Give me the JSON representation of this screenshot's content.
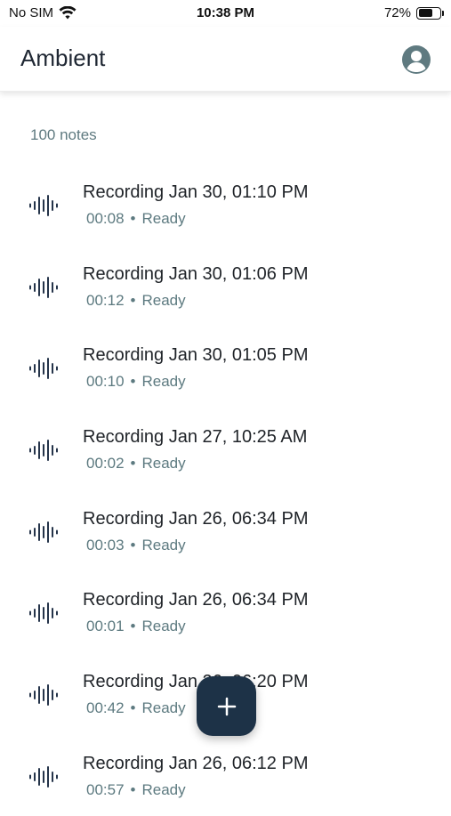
{
  "status_bar": {
    "carrier": "No SIM",
    "time": "10:38 PM",
    "battery_percent": "72%",
    "battery_level": 0.72
  },
  "header": {
    "title": "Ambient",
    "account_icon": "account-circle-icon"
  },
  "notes_count": "100 notes",
  "recordings": [
    {
      "title": "Recording Jan 30, 01:10 PM",
      "duration": "00:08",
      "status": "Ready"
    },
    {
      "title": "Recording Jan 30, 01:06 PM",
      "duration": "00:12",
      "status": "Ready"
    },
    {
      "title": "Recording Jan 30, 01:05 PM",
      "duration": "00:10",
      "status": "Ready"
    },
    {
      "title": "Recording Jan 27, 10:25 AM",
      "duration": "00:02",
      "status": "Ready"
    },
    {
      "title": "Recording Jan 26, 06:34 PM",
      "duration": "00:03",
      "status": "Ready"
    },
    {
      "title": "Recording Jan 26, 06:34 PM",
      "duration": "00:01",
      "status": "Ready"
    },
    {
      "title": "Recording Jan 26, 06:20 PM",
      "duration": "00:42",
      "status": "Ready"
    },
    {
      "title": "Recording Jan 26, 06:12 PM",
      "duration": "00:57",
      "status": "Ready"
    }
  ],
  "separator": "•",
  "fab": {
    "icon": "plus-icon"
  },
  "colors": {
    "fab_background": "#1d3247",
    "meta_text": "#5d7a80",
    "title_text": "#1f2328"
  }
}
